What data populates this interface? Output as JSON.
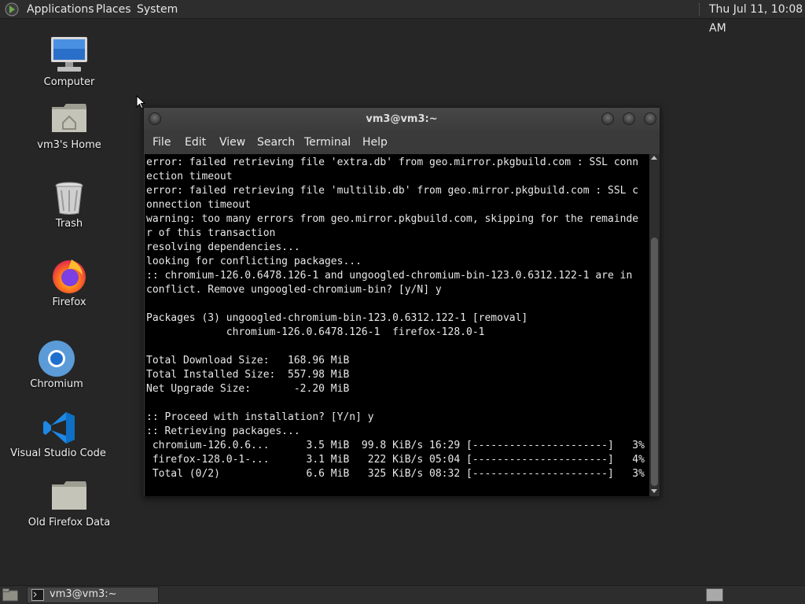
{
  "top_panel": {
    "menus": [
      "Applications",
      "Places",
      "System"
    ],
    "clock": "Thu Jul 11, 10:08 AM"
  },
  "desktop": {
    "icons": [
      {
        "label": "Computer",
        "icon": "computer-icon"
      },
      {
        "label": "vm3's Home",
        "icon": "home-folder-icon"
      },
      {
        "label": "Trash",
        "icon": "trash-icon"
      },
      {
        "label": "Firefox",
        "icon": "firefox-icon"
      },
      {
        "label": "Chromium",
        "icon": "chromium-icon"
      },
      {
        "label": "Visual Studio Code",
        "icon": "vscode-icon"
      },
      {
        "label": "Old Firefox Data",
        "icon": "folder-icon"
      }
    ]
  },
  "terminal": {
    "title": "vm3@vm3:~",
    "menu": [
      "File",
      "Edit",
      "View",
      "Search",
      "Terminal",
      "Help"
    ],
    "output": "error: failed retrieving file 'extra.db' from geo.mirror.pkgbuild.com : SSL conn\nection timeout\nerror: failed retrieving file 'multilib.db' from geo.mirror.pkgbuild.com : SSL c\nonnection timeout\nwarning: too many errors from geo.mirror.pkgbuild.com, skipping for the remainde\nr of this transaction\nresolving dependencies...\nlooking for conflicting packages...\n:: chromium-126.0.6478.126-1 and ungoogled-chromium-bin-123.0.6312.122-1 are in\nconflict. Remove ungoogled-chromium-bin? [y/N] y\n\nPackages (3) ungoogled-chromium-bin-123.0.6312.122-1 [removal]\n             chromium-126.0.6478.126-1  firefox-128.0-1\n\nTotal Download Size:   168.96 MiB\nTotal Installed Size:  557.98 MiB\nNet Upgrade Size:       -2.20 MiB\n\n:: Proceed with installation? [Y/n] y\n:: Retrieving packages...\n chromium-126.0.6...      3.5 MiB  99.8 KiB/s 16:29 [----------------------]   3%\n firefox-128.0-1-...      3.1 MiB   222 KiB/s 05:04 [----------------------]   4%\n Total (0/2)              6.6 MiB   325 KiB/s 08:32 [----------------------]   3%"
  },
  "taskbar": {
    "task_label": "vm3@vm3:~"
  },
  "colors": {
    "desktop_bg": "#262626",
    "panel_bg": "#2d2d2d",
    "terminal_bg": "#000000",
    "terminal_fg": "#e8e8e8"
  }
}
